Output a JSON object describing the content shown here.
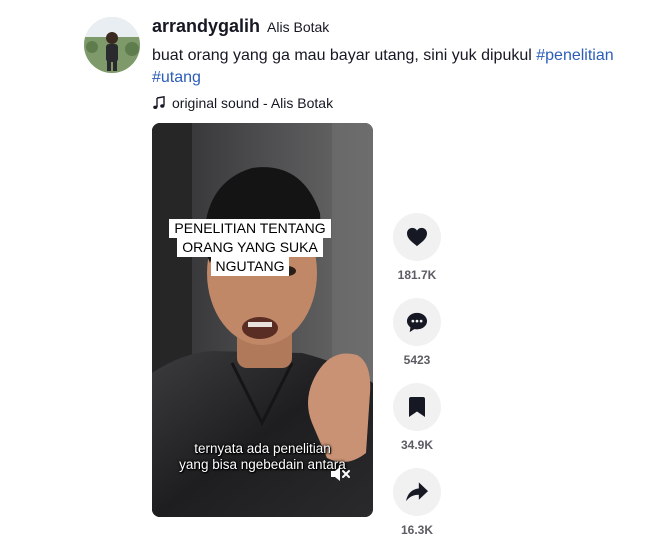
{
  "post": {
    "username": "arrandygalih",
    "nickname": "Alis Botak",
    "caption_text": "buat orang yang ga mau bayar utang, sini yuk dipukul ",
    "hashtags": [
      "#penelitian",
      "#utang"
    ],
    "sound": "original sound - Alis Botak"
  },
  "video": {
    "overlay_lines": [
      "PENELITIAN TENTANG",
      "ORANG YANG SUKA",
      "NGUTANG"
    ],
    "subtitle_lines": [
      "ternyata ada penelitian",
      "yang bisa ngebedain antara"
    ]
  },
  "actions": {
    "like": {
      "icon": "heart-icon",
      "count": "181.7K"
    },
    "comment": {
      "icon": "comment-icon",
      "count": "5423"
    },
    "bookmark": {
      "icon": "bookmark-icon",
      "count": "34.9K"
    },
    "share": {
      "icon": "share-icon",
      "count": "16.3K"
    }
  },
  "colors": {
    "hashtag": "#2b5db9",
    "action_bg": "#f1f1f2",
    "count": "#5c5d63"
  }
}
